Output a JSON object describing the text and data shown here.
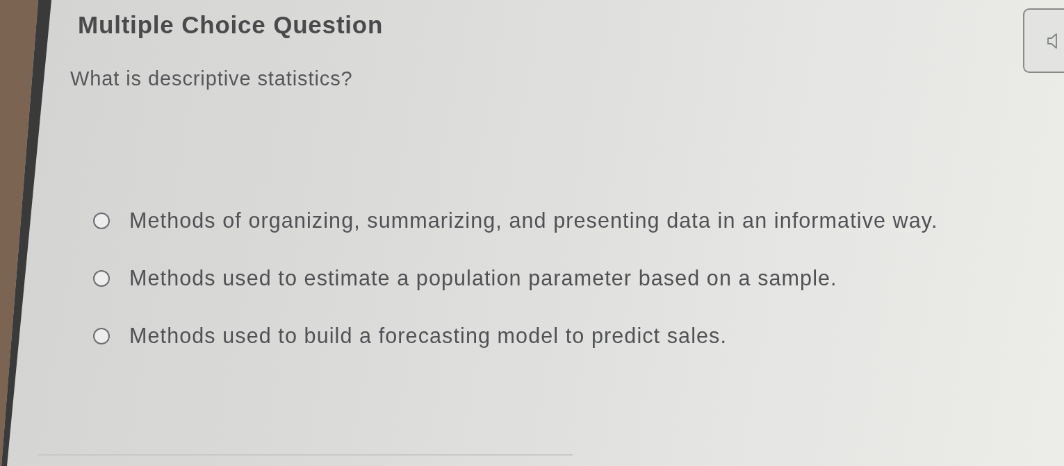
{
  "question": {
    "header": "Multiple Choice Question",
    "prompt": "What is descriptive statistics?"
  },
  "options": [
    {
      "label": "Methods of organizing, summarizing, and presenting data in an informative way.",
      "selected": false
    },
    {
      "label": "Methods used to estimate a population parameter based on a sample.",
      "selected": false
    },
    {
      "label": "Methods used to build a forecasting model to predict sales.",
      "selected": false
    }
  ]
}
